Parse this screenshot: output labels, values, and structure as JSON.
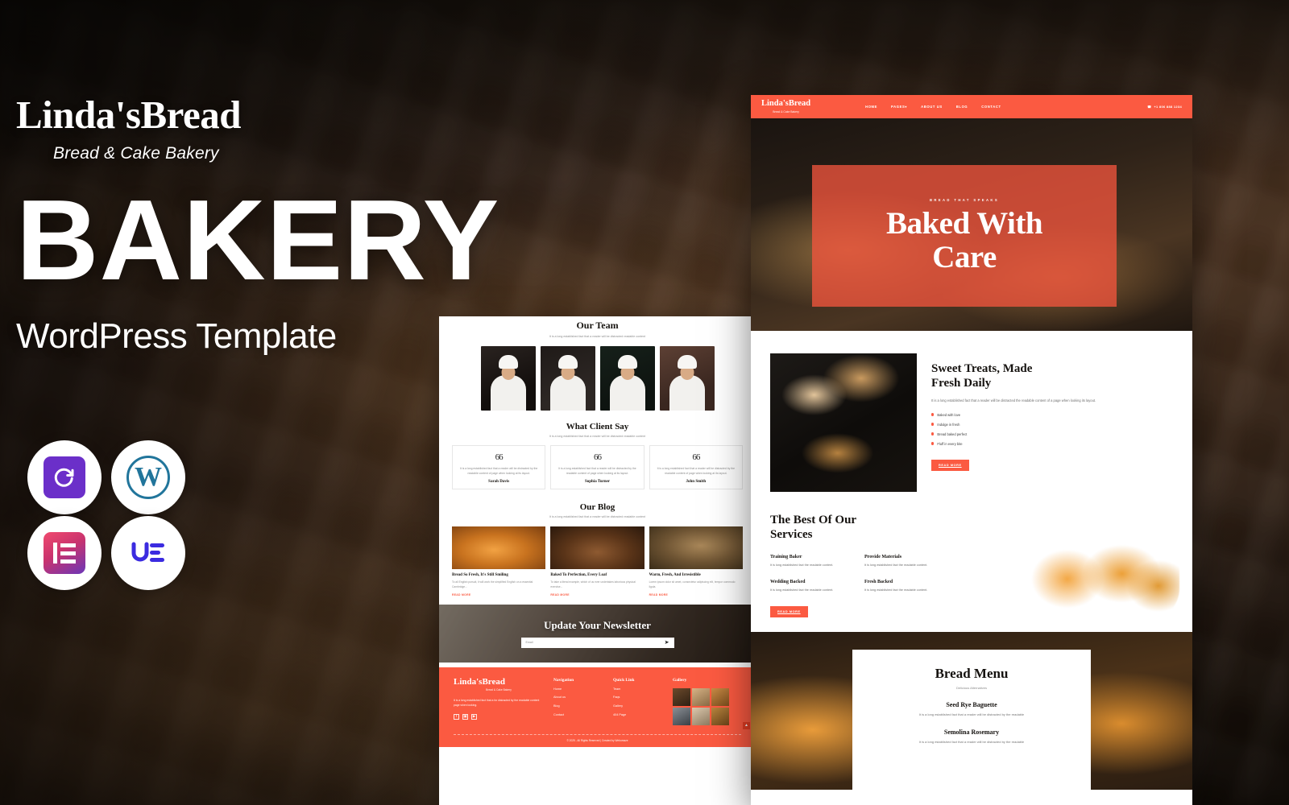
{
  "promo": {
    "brand_name": "Linda'sBread",
    "brand_tagline": "Bread & Cake Bakery",
    "headline": "BAKERY",
    "subheadline": "WordPress Template"
  },
  "badges": [
    {
      "name": "templatemonster-icon",
      "label": "TM"
    },
    {
      "name": "wordpress-icon",
      "label": "W"
    },
    {
      "name": "elementor-icon",
      "label": "E"
    },
    {
      "name": "unlimited-elements-icon",
      "label": "UE"
    }
  ],
  "site": {
    "header": {
      "logo": "Linda'sBread",
      "logo_sub": "Bread & Cake Bakery",
      "nav": [
        "HOME",
        "PAGES",
        "ABOUT US",
        "BLOG",
        "CONTACT"
      ],
      "pages_caret": "▾",
      "phone_icon": "☎",
      "phone": "+1 806 888 1234"
    },
    "hero": {
      "eyebrow": "BREAD THAT SPEAKS",
      "title_line1": "Baked With",
      "title_line2": "Care"
    },
    "about": {
      "title_line1": "Sweet Treats, Made",
      "title_line2": "Fresh Daily",
      "paragraph": "It is a long established fact that a reader will be distracted the readable content of a page when looking its layout.",
      "bullets": [
        "Baked with love",
        "Indulge in fresh",
        "Bread baked perfect",
        "Fluff in every bite"
      ],
      "cta": "READ MORE"
    },
    "services": {
      "title_line1": "The Best Of Our",
      "title_line2": "Services",
      "items": [
        {
          "title": "Training Baker",
          "desc": "It is long established fact the readable content."
        },
        {
          "title": "Provide Materials",
          "desc": "It is long established fact the readable content."
        },
        {
          "title": "Wedding Backed",
          "desc": "It is long established fact the readable content."
        },
        {
          "title": "Fresh Backed",
          "desc": "It is long established fact the readable content."
        }
      ],
      "cta": "READ MORE"
    },
    "menu": {
      "title": "Bread Menu",
      "subtitle": "Delicious Alternatives",
      "items": [
        {
          "name": "Seed Rye Baguette",
          "desc": "It is a long established fact that a reader will be distracted by the readable"
        },
        {
          "name": "Semolina Rosemary",
          "desc": "It is a long established fact that a reader will be distracted by the readable"
        }
      ]
    }
  },
  "page": {
    "team": {
      "title": "Our Team",
      "subtitle": "It is a long established fact that a reader will be distracted readable content",
      "members": [
        "chef-one",
        "chef-two",
        "chef-three",
        "chef-four"
      ]
    },
    "testimonials": {
      "title": "What Client Say",
      "subtitle": "It is a long established fact that a reader will be distracted readable content",
      "quote_mark": "66",
      "cards": [
        {
          "text": "It is a long established fact that a reader will be distracted by the readable content of page when looking at its layout.",
          "author": "Sarah Davis"
        },
        {
          "text": "It is a long established fact that a reader will be distracted by the readable content of page when looking at its layout.",
          "author": "Sophia Turner"
        },
        {
          "text": "It is a long established fact that a reader will be distracted by the readable content of page when looking at its layout.",
          "author": "John Smith"
        }
      ]
    },
    "blog": {
      "title": "Our Blog",
      "subtitle": "It is a long established fact that a reader will be distracted readable content",
      "posts": [
        {
          "title": "Bread So Fresh, It's Still Smiling",
          "excerpt": "To all English pursuit, it will work the simplified English on a essential Cambridge...",
          "more": "READ MORE"
        },
        {
          "title": "Baked To Perfection, Every Loaf",
          "excerpt": "To take a literal example, which of us ever undertakes laborious physical exercise...",
          "more": "READ MORE"
        },
        {
          "title": "Warm, Fresh, And Irresistible",
          "excerpt": "Lorem ipsum dolor sit amet, consectetur adipiscing elit, tempor commodo ligula.",
          "more": "READ MORE"
        }
      ]
    },
    "newsletter": {
      "title": "Update Your Newsletter",
      "placeholder": "Email",
      "send_icon": "➤"
    },
    "footer": {
      "logo": "Linda'sBread",
      "logo_sub": "Bread & Cake Bakery",
      "description": "It is a long established fact that a for distracted by the readable content page when looking.",
      "socials": [
        "f",
        "▣",
        "▶"
      ],
      "nav_heading": "Navigation",
      "nav_links": [
        "Home",
        "About us",
        "Blog",
        "Contact"
      ],
      "quick_heading": "Quick Link",
      "quick_links": [
        "Team",
        "Faqs",
        "Gallery",
        "404 Page"
      ],
      "gallery_heading": "Gallery",
      "gallery_count": 6,
      "copyright": "© 2025 - All Rights Reserved | Created by Webomaze",
      "to_top_icon": "▲"
    }
  },
  "colors": {
    "accent": "#FB5A41",
    "accent_dark": "#E23C22",
    "wordpress_blue": "#21759B",
    "elementor_pink": "#D0336E",
    "ue_blue": "#3B2BE0",
    "tm_purple": "#6B2FC9"
  }
}
